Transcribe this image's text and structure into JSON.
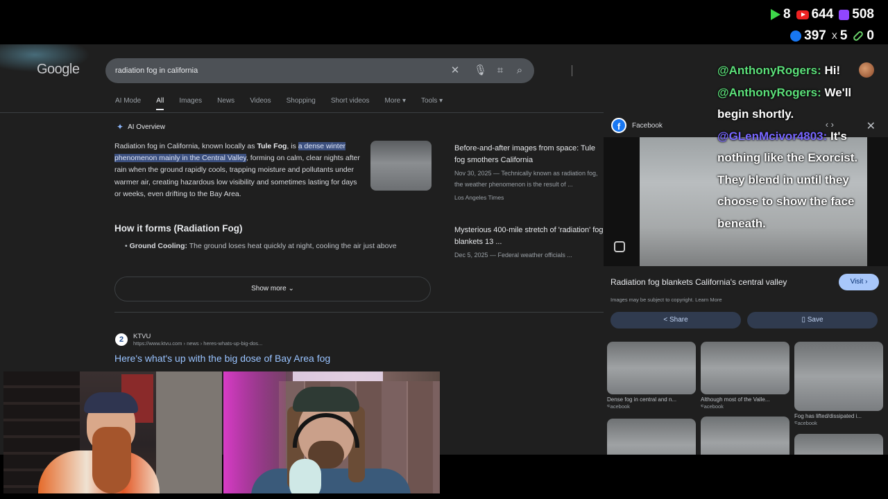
{
  "stream": {
    "stats": [
      {
        "icon": "play-icon",
        "value": "8"
      },
      {
        "icon": "youtube-icon",
        "value": "644"
      },
      {
        "icon": "twitch-icon",
        "value": "508"
      },
      {
        "icon": "facebook-icon",
        "value": "397"
      },
      {
        "icon": "x-icon",
        "value": "5"
      },
      {
        "icon": "link-icon",
        "value": "0"
      }
    ],
    "x_glyph": "x"
  },
  "google": {
    "logo": "Google",
    "query": "radiation fog in california",
    "tabs": [
      "AI Mode",
      "All",
      "Images",
      "News",
      "Videos",
      "Shopping",
      "Short videos",
      "More ▾",
      "Tools ▾"
    ],
    "active_tab": "All"
  },
  "ai_overview": {
    "heading": "AI Overview",
    "text_1": "Radiation fog in California, known locally as ",
    "text_bold": "Tule Fog",
    "text_2": ", is ",
    "text_hl": "a dense winter phenomenon mainly in the Central Valley",
    "text_3": ", forming on calm, clear nights after rain when the ground rapidly cools, trapping moisture and pollutants under warmer air, creating hazardous low visibility and sometimes lasting for days or weeks, even drifting to the Bay Area.",
    "section_heading": "How it forms (Radiation Fog)",
    "bullet_label": "Ground Cooling:",
    "bullet_text": " The ground loses heat quickly at night, cooling the air just above",
    "show_more": "Show more"
  },
  "side_results": [
    {
      "title": "Before-and-after images from space: Tule fog smothers California",
      "snippet": "Nov 30, 2025 — Technically known as radiation fog, the weather phenomenon is the result of ...",
      "source": "Los Angeles Times"
    },
    {
      "title": "Mysterious 400-mile stretch of 'radiation' fog blankets 13 ...",
      "snippet": "Dec 5, 2025 — Federal weather officials ..."
    }
  ],
  "result": {
    "site_name": "KTVU",
    "site_url": "https://www.ktvu.com › news › heres-whats-up-big-dos...",
    "title": "Here's what's up with the big dose of Bay Area fog"
  },
  "panel": {
    "source_name": "Facebook",
    "image_title": "Radiation fog blankets California's central valley",
    "visit": "Visit ›",
    "copyright": "Images may be subject to copyright. Learn More",
    "share": "Share",
    "save": "Save",
    "thumbs": [
      {
        "caption": "Dense fog in central and n...",
        "source": "Facebook"
      },
      {
        "caption": "Although most of the Valle...",
        "source": "Facebook"
      },
      {
        "caption": "Fog has lifted/dissipated i...",
        "source": "Facebook"
      },
      {
        "caption": "",
        "source": ""
      },
      {
        "caption": "",
        "source": ""
      },
      {
        "caption": "",
        "source": ""
      }
    ]
  },
  "chat": {
    "messages": [
      {
        "user": "@AnthonyRogers:",
        "text": " Hi!"
      },
      {
        "user": "@AnthonyRogers:",
        "text": " We'll begin shortly."
      },
      {
        "user": "@GLenMcivor4803:",
        "text": " It's nothing like the Exorcist. They blend in until they choose to show the face beneath."
      }
    ]
  }
}
